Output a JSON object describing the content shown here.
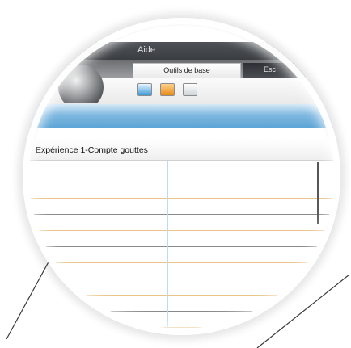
{
  "menu": {
    "aide_label": "Aide"
  },
  "toolbar": {
    "tab_basic_tools": "Outils de base",
    "tab_partial": "Esc",
    "tools": [
      {
        "name": "new",
        "icon": "new-document-icon"
      },
      {
        "name": "open",
        "icon": "folder-icon"
      },
      {
        "name": "save",
        "icon": "save-icon"
      }
    ]
  },
  "document": {
    "title": "Expérience 1-Compte gouttes"
  },
  "colors": {
    "accent_blue": "#5aa3d5",
    "row_orange": "#e9c58a",
    "row_gray": "#8a8a8a",
    "menubar": "#3a3d42"
  }
}
